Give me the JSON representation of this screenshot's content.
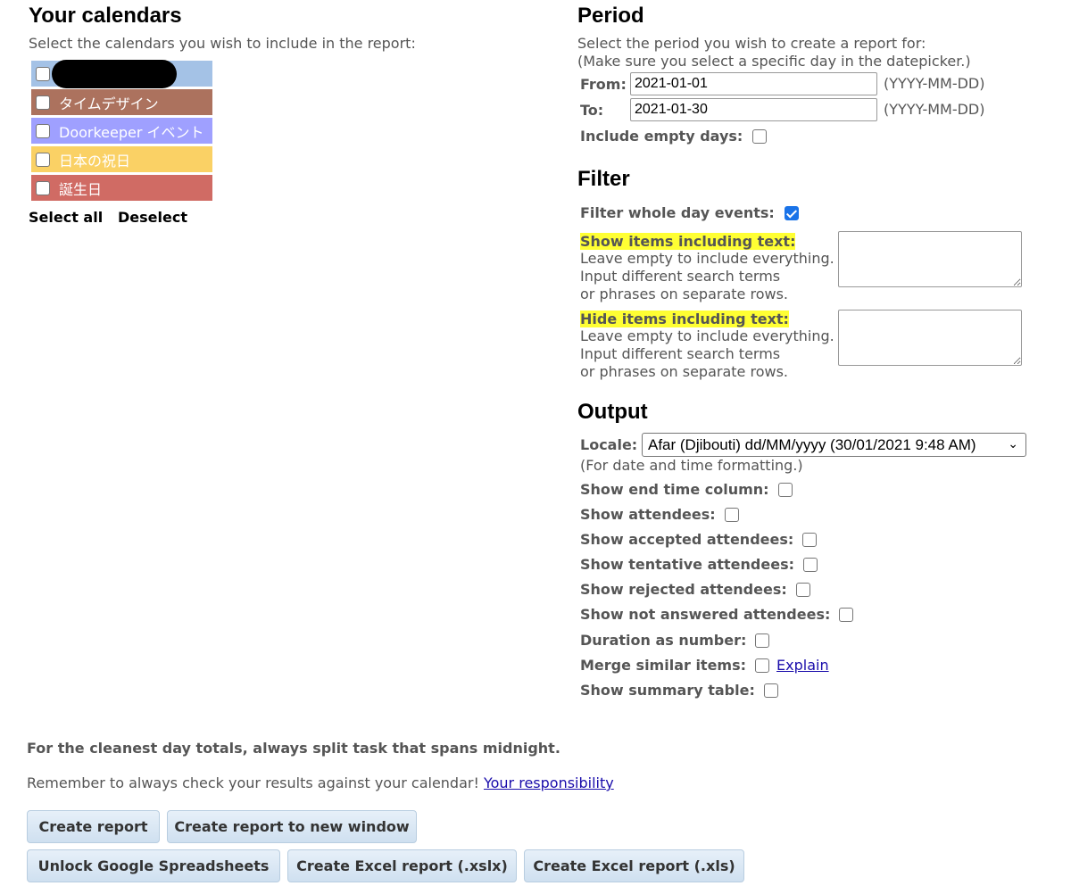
{
  "calendars": {
    "title": "Your calendars",
    "instruction": "Select the calendars you wish to include in the report:",
    "items": [
      {
        "label": "",
        "color": "#a4c2e6",
        "checked": false
      },
      {
        "label": "タイムデザイン",
        "color": "#ac725e",
        "checked": false
      },
      {
        "label": "Doorkeeper イベント",
        "color": "#9fa0ff",
        "checked": false
      },
      {
        "label": "日本の祝日",
        "color": "#fad165",
        "checked": false
      },
      {
        "label": "誕生日",
        "color": "#d06b64",
        "checked": false
      }
    ],
    "select_all": "Select all",
    "deselect": "Deselect"
  },
  "period": {
    "title": "Period",
    "instruction1": "Select the period you wish to create a report for:",
    "instruction2": "(Make sure you select a specific day in the datepicker.)",
    "from_label": "From:",
    "from_value": "2021-01-01",
    "to_label": "To:",
    "to_value": "2021-01-30",
    "format_hint": "(YYYY-MM-DD)",
    "include_empty_days": "Include empty days:"
  },
  "filter": {
    "title": "Filter",
    "whole_day_label": "Filter whole day events:",
    "whole_day_checked": true,
    "show_label": "Show items including text:",
    "hide_label": "Hide items including text:",
    "help1": "Leave empty to include everything.",
    "help2": "Input different search terms",
    "help3": "or phrases on separate rows."
  },
  "output": {
    "title": "Output",
    "locale_label": "Locale:",
    "locale_value": "Afar (Djibouti) dd/MM/yyyy (30/01/2021 9:48 AM)",
    "locale_hint": "(For date and time formatting.)",
    "options": {
      "end_time": "Show end time column:",
      "attendees": "Show attendees:",
      "accepted": "Show accepted attendees:",
      "tentative": "Show tentative attendees:",
      "rejected": "Show rejected attendees:",
      "not_answered": "Show not answered attendees:",
      "duration": "Duration as number:",
      "merge": "Merge similar items:",
      "summary": "Show summary table:"
    },
    "explain_link": "Explain"
  },
  "footer": {
    "tip": "For the cleanest day totals, always split task that spans midnight.",
    "remember": "Remember to always check your results against your calendar!",
    "responsibility_link": "Your responsibility",
    "buttons": {
      "create": "Create report",
      "create_new_window": "Create report to new window",
      "unlock_sheets": "Unlock Google Spreadsheets",
      "excel_xlsx": "Create Excel report (.xslx)",
      "excel_xls": "Create Excel report (.xls)"
    }
  },
  "colors": {
    "checkbox_checked": "#1a73e8",
    "highlight": "#ffff33",
    "button_bg": "#dbe8f5"
  }
}
